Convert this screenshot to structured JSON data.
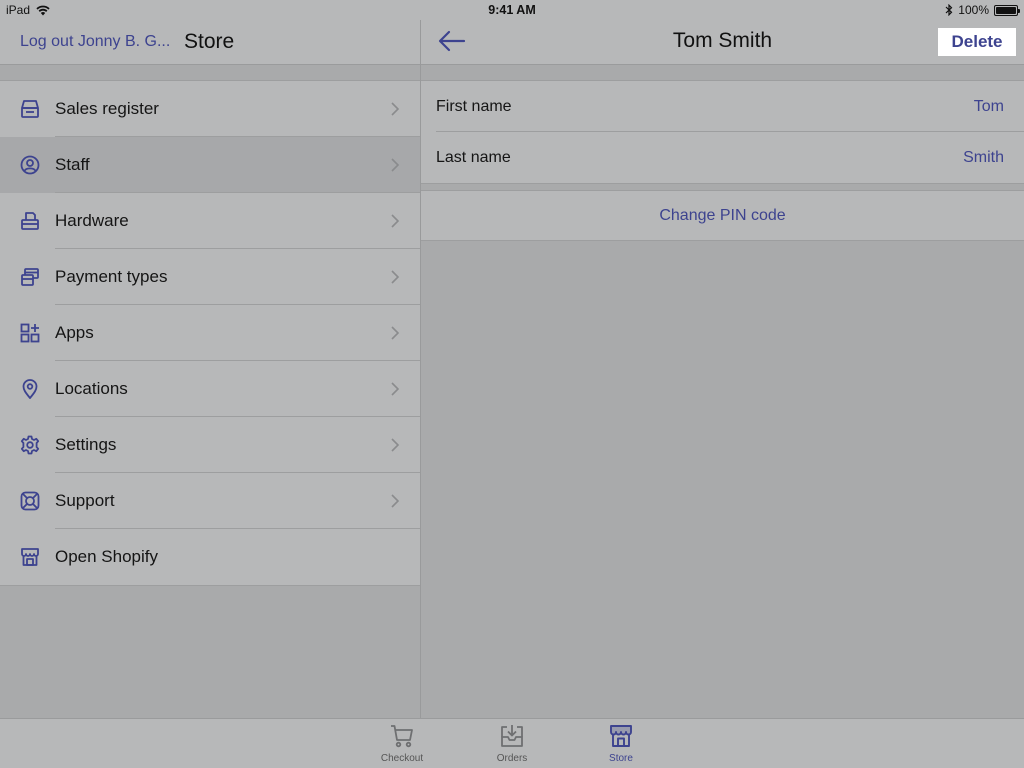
{
  "status_bar": {
    "device": "iPad",
    "time": "9:41 AM",
    "battery": "100%"
  },
  "master": {
    "logout_label": "Log out Jonny B. G...",
    "title": "Store",
    "items": [
      {
        "label": "Sales register",
        "icon": "register-icon",
        "chevron": true,
        "selected": false
      },
      {
        "label": "Staff",
        "icon": "user-circle-icon",
        "chevron": true,
        "selected": true
      },
      {
        "label": "Hardware",
        "icon": "printer-icon",
        "chevron": true,
        "selected": false
      },
      {
        "label": "Payment types",
        "icon": "cards-icon",
        "chevron": true,
        "selected": false
      },
      {
        "label": "Apps",
        "icon": "apps-grid-icon",
        "chevron": true,
        "selected": false
      },
      {
        "label": "Locations",
        "icon": "location-pin-icon",
        "chevron": true,
        "selected": false
      },
      {
        "label": "Settings",
        "icon": "gear-icon",
        "chevron": true,
        "selected": false
      },
      {
        "label": "Support",
        "icon": "lifebuoy-icon",
        "chevron": true,
        "selected": false
      },
      {
        "label": "Open Shopify",
        "icon": "storefront-icon",
        "chevron": false,
        "selected": false
      }
    ]
  },
  "detail": {
    "title": "Tom Smith",
    "delete_label": "Delete",
    "fields": [
      {
        "label": "First name",
        "value": "Tom"
      },
      {
        "label": "Last name",
        "value": "Smith"
      }
    ],
    "change_pin_label": "Change PIN code"
  },
  "tabs": [
    {
      "label": "Checkout",
      "icon": "cart-icon",
      "active": false
    },
    {
      "label": "Orders",
      "icon": "inbox-download-icon",
      "active": false
    },
    {
      "label": "Store",
      "icon": "store-icon",
      "active": true
    }
  ],
  "colors": {
    "accent": "#3d438f",
    "background": "#a9aaab",
    "surface": "#b7b8b9"
  }
}
